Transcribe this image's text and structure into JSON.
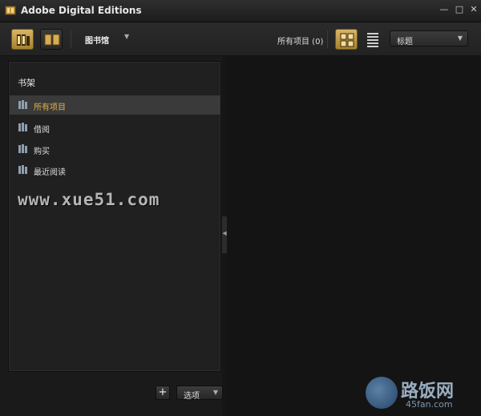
{
  "window": {
    "title": "Adobe Digital Editions",
    "controls": [
      "—",
      "□",
      "✕"
    ]
  },
  "toolbar": {
    "library_label": "图书馆",
    "item_count": "所有项目 (0)",
    "sort_selected": "标题"
  },
  "shelf": {
    "title": "书架",
    "items": [
      {
        "label": "所有项目",
        "selected": true
      },
      {
        "label": "借阅",
        "selected": false
      },
      {
        "label": "购买",
        "selected": false
      },
      {
        "label": "最近阅读",
        "selected": false
      }
    ]
  },
  "bottom": {
    "add_label": "+",
    "options_label": "选项"
  },
  "watermarks": {
    "site1": "www.xue51.com",
    "site2_name": "路饭网",
    "site2_domain": "45fan.com"
  },
  "colors": {
    "accent": "#e0b24b",
    "active_button": "#c9a24e",
    "background": "#1a1a1a"
  }
}
